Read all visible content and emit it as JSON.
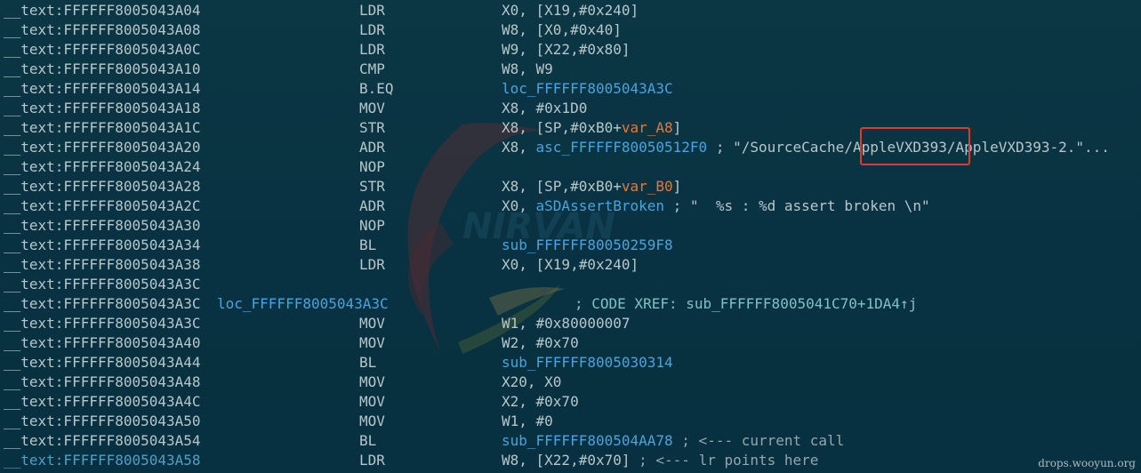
{
  "lines": [
    {
      "addr": "__text:FFFFFF8005043A04",
      "label": "",
      "mnem": "LDR",
      "ops": [
        {
          "t": "X0, [X19,#0x240]",
          "c": "plain"
        }
      ]
    },
    {
      "addr": "__text:FFFFFF8005043A08",
      "label": "",
      "mnem": "LDR",
      "ops": [
        {
          "t": "W8, [X0,#0x40]",
          "c": "plain"
        }
      ]
    },
    {
      "addr": "__text:FFFFFF8005043A0C",
      "label": "",
      "mnem": "LDR",
      "ops": [
        {
          "t": "W9, [X22,#0x80]",
          "c": "plain"
        }
      ]
    },
    {
      "addr": "__text:FFFFFF8005043A10",
      "label": "",
      "mnem": "CMP",
      "ops": [
        {
          "t": "W8, W9",
          "c": "plain"
        }
      ]
    },
    {
      "addr": "__text:FFFFFF8005043A14",
      "label": "",
      "mnem": "B.EQ",
      "ops": [
        {
          "t": "loc_FFFFFF8005043A3C",
          "c": "ref"
        }
      ]
    },
    {
      "addr": "__text:FFFFFF8005043A18",
      "label": "",
      "mnem": "MOV",
      "ops": [
        {
          "t": "X8, #0x1D0",
          "c": "plain"
        }
      ]
    },
    {
      "addr": "__text:FFFFFF8005043A1C",
      "label": "",
      "mnem": "STR",
      "ops": [
        {
          "t": "X8, [SP,#0xB0+",
          "c": "plain"
        },
        {
          "t": "var_A8",
          "c": "var"
        },
        {
          "t": "]",
          "c": "plain"
        }
      ]
    },
    {
      "addr": "__text:FFFFFF8005043A20",
      "label": "",
      "mnem": "ADR",
      "ops": [
        {
          "t": "X8, ",
          "c": "plain"
        },
        {
          "t": "asc_FFFFFF80050512F0",
          "c": "ref"
        },
        {
          "t": " ; \"/SourceCache/AppleVXD393/AppleVXD393-2.\"...",
          "c": "cmt"
        }
      ]
    },
    {
      "addr": "__text:FFFFFF8005043A24",
      "label": "",
      "mnem": "NOP",
      "ops": []
    },
    {
      "addr": "__text:FFFFFF8005043A28",
      "label": "",
      "mnem": "STR",
      "ops": [
        {
          "t": "X8, [SP,#0xB0+",
          "c": "plain"
        },
        {
          "t": "var_B0",
          "c": "var"
        },
        {
          "t": "]",
          "c": "plain"
        }
      ]
    },
    {
      "addr": "__text:FFFFFF8005043A2C",
      "label": "",
      "mnem": "ADR",
      "ops": [
        {
          "t": "X0, ",
          "c": "plain"
        },
        {
          "t": "aSDAssertBroken",
          "c": "ref"
        },
        {
          "t": " ; \"  %s : %d assert broken \\n\"",
          "c": "cmt"
        }
      ]
    },
    {
      "addr": "__text:FFFFFF8005043A30",
      "label": "",
      "mnem": "NOP",
      "ops": []
    },
    {
      "addr": "__text:FFFFFF8005043A34",
      "label": "",
      "mnem": "BL",
      "ops": [
        {
          "t": "sub_FFFFFF80050259F8",
          "c": "ref"
        }
      ]
    },
    {
      "addr": "__text:FFFFFF8005043A38",
      "label": "",
      "mnem": "LDR",
      "ops": [
        {
          "t": "X0, [X19,#0x240]",
          "c": "plain"
        }
      ]
    },
    {
      "addr": "__text:FFFFFF8005043A3C",
      "label": "",
      "mnem": "",
      "ops": []
    },
    {
      "addr": "__text:FFFFFF8005043A3C",
      "label": "loc_FFFFFF8005043A3C",
      "mnem": "",
      "ops": [],
      "xref": "; CODE XREF: sub_FFFFFF8005041C70+1DA4↑j"
    },
    {
      "addr": "__text:FFFFFF8005043A3C",
      "label": "",
      "mnem": "MOV",
      "ops": [
        {
          "t": "W1, #0x80000007",
          "c": "plain"
        }
      ]
    },
    {
      "addr": "__text:FFFFFF8005043A40",
      "label": "",
      "mnem": "MOV",
      "ops": [
        {
          "t": "W2, #0x70",
          "c": "plain"
        }
      ]
    },
    {
      "addr": "__text:FFFFFF8005043A44",
      "label": "",
      "mnem": "BL",
      "ops": [
        {
          "t": "sub_FFFFFF8005030314",
          "c": "ref"
        }
      ]
    },
    {
      "addr": "__text:FFFFFF8005043A48",
      "label": "",
      "mnem": "MOV",
      "ops": [
        {
          "t": "X20, X0",
          "c": "plain"
        }
      ]
    },
    {
      "addr": "__text:FFFFFF8005043A4C",
      "label": "",
      "mnem": "MOV",
      "ops": [
        {
          "t": "X2, #0x70",
          "c": "plain"
        }
      ]
    },
    {
      "addr": "__text:FFFFFF8005043A50",
      "label": "",
      "mnem": "MOV",
      "ops": [
        {
          "t": "W1, #0",
          "c": "plain"
        }
      ]
    },
    {
      "addr": "__text:FFFFFF8005043A54",
      "label": "",
      "mnem": "BL",
      "ops": [
        {
          "t": "sub_FFFFFF800504AA78",
          "c": "ref"
        },
        {
          "t": " ; <--- current call",
          "c": "cmtplain"
        }
      ]
    },
    {
      "addr": "__text:FFFFFF8005043A58",
      "label": "",
      "mnem": "LDR",
      "ops": [
        {
          "t": "W8, [X22,#0x70]",
          "c": "plain"
        },
        {
          "t": " ; <--- lr points here",
          "c": "cmtplain"
        }
      ],
      "selected": true
    }
  ],
  "watermark": {
    "text": "NIRVAN"
  },
  "site_mark": "drops.wooyun.org",
  "colors": {
    "background": "#0a3340",
    "text": "#b7c6ca",
    "reference": "#4aa3dc",
    "variable": "#e07a3a",
    "xref_comment": "#7fc2c3",
    "highlight_box": "#e03a2a"
  }
}
